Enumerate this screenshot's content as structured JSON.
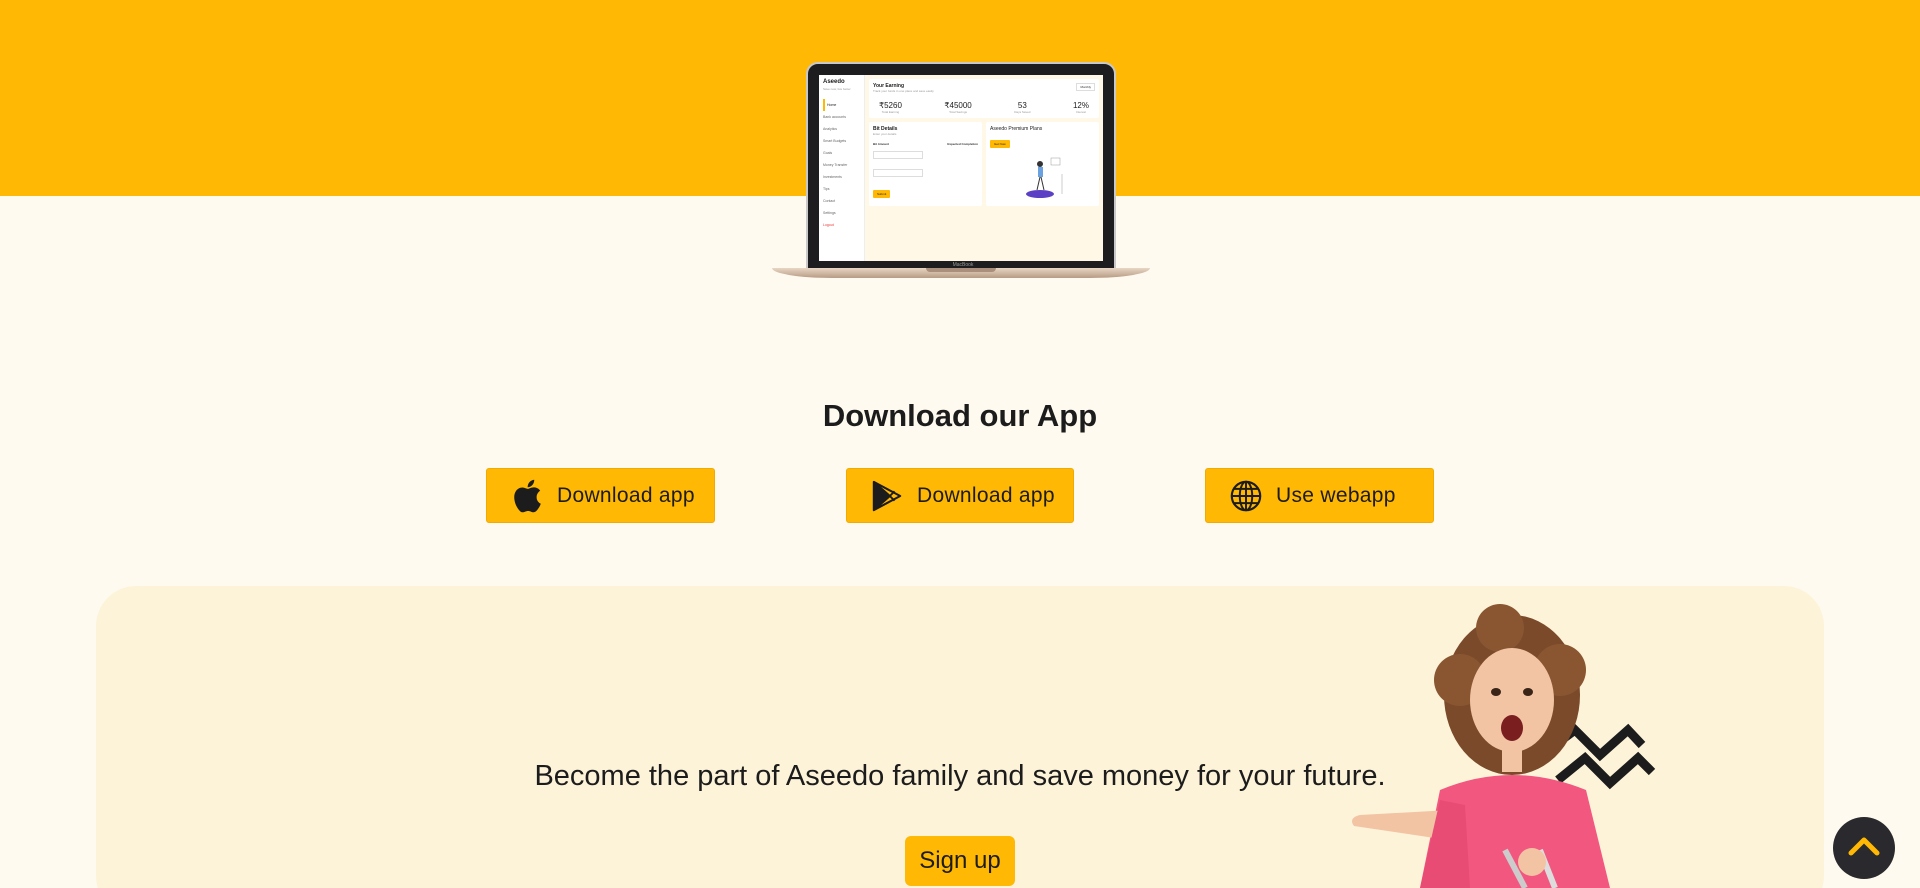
{
  "colors": {
    "accent": "#ffb804",
    "background": "#fffaef",
    "card": "#fdf3d8",
    "dark": "#2a2a2e"
  },
  "laptop_screen": {
    "brand": "Aseedo",
    "tagline": "Save now, live better",
    "device_label": "MacBook",
    "sidebar": [
      "Home",
      "Bank accounts",
      "Analytics",
      "Smart Budgets",
      "Goals",
      "Money Transfer",
      "Investments",
      "Tips",
      "Contact",
      "Settings"
    ],
    "sidebar_logout": "Logout",
    "header_title": "Your Earning",
    "header_sub": "Track your funds in one place and save easily",
    "header_button": "Monthly",
    "stats": [
      {
        "value": "₹5260",
        "label": "Total Earning"
      },
      {
        "value": "₹45000",
        "label": "Total Savings"
      },
      {
        "value": "53",
        "label": "Days Saved"
      },
      {
        "value": "12%",
        "label": "Interest"
      }
    ],
    "form_title": "Bit Details",
    "form_sub": "Enter your details",
    "form_field1": "Bit Amount",
    "form_field2": "Expected Completion",
    "form_button": "Submit",
    "promo_title": "Aseedo Premium Plans",
    "promo_button": "Get Now"
  },
  "download": {
    "title": "Download our App",
    "ios_label": "Download app",
    "play_label": "Download app",
    "web_label": "Use webapp"
  },
  "signup": {
    "text": "Become the part of Aseedo family and save money for your future.",
    "button": "Sign up"
  },
  "icons": {
    "ios": "apple-icon",
    "play": "play-store-icon",
    "web": "globe-icon",
    "back": "chevron-up-icon"
  }
}
